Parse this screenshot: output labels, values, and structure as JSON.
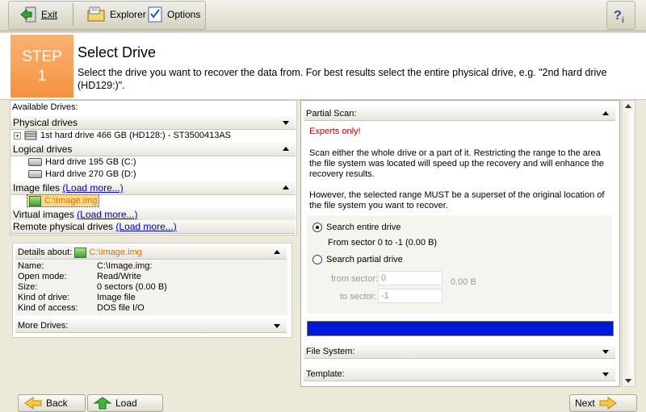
{
  "toolbar": {
    "exit_label": "Exit",
    "explorer_label": "Explorer",
    "options_label": "Options",
    "help_icon": "help-icon"
  },
  "step": {
    "line1": "STEP",
    "line2": "1"
  },
  "header": {
    "title": "Select Drive",
    "description": "Select the drive you want to recover the data from. For best results select the entire physical drive, e.g. \"2nd hard drive (HD129:)\"."
  },
  "drives": {
    "available_label": "Available Drives:",
    "physical_label": "Physical drives",
    "physical_item": "1st hard drive 466 GB (HD128:) - ST3500413AS",
    "logical_label": "Logical drives",
    "logical_items": [
      "Hard drive 195 GB (C:)",
      "Hard drive 270 GB (D:)"
    ],
    "image_files_label": "Image files",
    "load_more": "(Load more...)",
    "image_item": "C:\\Image.img",
    "virtual_label": "Virtual images",
    "remote_label": "Remote physical drives"
  },
  "details": {
    "header_label": "Details about:",
    "header_value": "C:\\Image.img",
    "rows": [
      {
        "k": "Name:",
        "v": "C:\\Image.img:"
      },
      {
        "k": "Open mode:",
        "v": "Read/Write"
      },
      {
        "k": "Size:",
        "v": "0 sectors (0.00 B)"
      },
      {
        "k": "Kind of drive:",
        "v": "Image file"
      },
      {
        "k": "Kind of access:",
        "v": "DOS file I/O"
      }
    ],
    "more_drives": "More Drives:"
  },
  "scan": {
    "header": "Partial Scan:",
    "experts": "Experts only!",
    "para1": "Scan either the whole drive or a part of it. Restricting the range to the area the file system was located will speed up the recovery and will enhance the recovery results.",
    "para2": "However, the selected range MUST be a superset of the original location of the file system you want to recover.",
    "opt_entire": "Search entire drive",
    "entire_range": "From sector 0 to -1 (0.00 B)",
    "opt_partial": "Search partial drive",
    "from_label": "from sector:",
    "from_value": "0",
    "to_label": "to sector:",
    "to_value": "-1",
    "size_value": "0.00 B",
    "progress": 1.0,
    "progress_color": "#0018d8",
    "file_system": "File System:",
    "template": "Template:"
  },
  "bottom": {
    "back_label": "Back",
    "load_label": "Load",
    "next_label": "Next"
  },
  "colors": {
    "step_bg": "#f49340",
    "experts": "#cc0000",
    "link": "#0000cc",
    "image_item": "#e07000"
  }
}
